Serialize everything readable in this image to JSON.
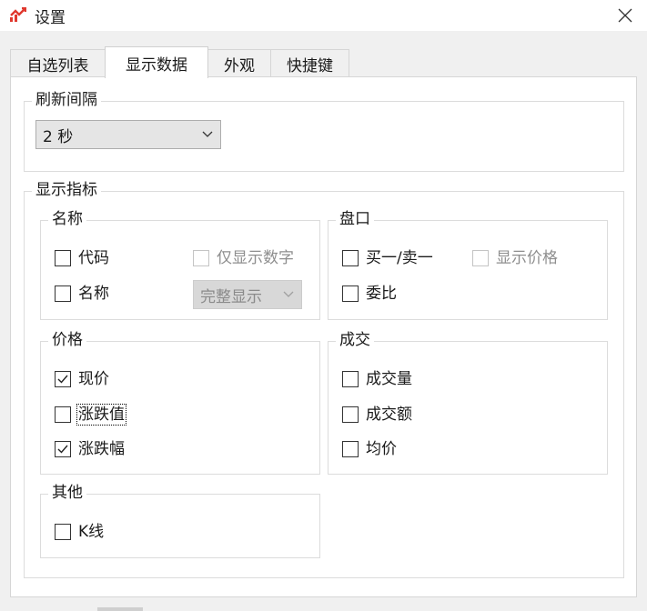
{
  "window": {
    "title": "设置",
    "accent": "#e0382e"
  },
  "tabs": [
    {
      "label": "自选列表",
      "active": false
    },
    {
      "label": "显示数据",
      "active": true
    },
    {
      "label": "外观",
      "active": false
    },
    {
      "label": "快捷键",
      "active": false
    }
  ],
  "refresh": {
    "title": "刷新间隔",
    "selected": "2 秒"
  },
  "indicators": {
    "title": "显示指标",
    "name_group": {
      "title": "名称",
      "code": {
        "label": "代码",
        "checked": false
      },
      "only_digits": {
        "label": "仅显示数字",
        "checked": false,
        "disabled": true
      },
      "name": {
        "label": "名称",
        "checked": false
      },
      "display_mode": {
        "selected": "完整显示",
        "disabled": true
      }
    },
    "orderbook_group": {
      "title": "盘口",
      "bid_ask": {
        "label": "买一/卖一",
        "checked": false
      },
      "show_price": {
        "label": "显示价格",
        "checked": false,
        "disabled": true
      },
      "ratio": {
        "label": "委比",
        "checked": false
      }
    },
    "price_group": {
      "title": "价格",
      "current": {
        "label": "现价",
        "checked": true
      },
      "change": {
        "label": "涨跌值",
        "checked": false
      },
      "change_pct": {
        "label": "涨跌幅",
        "checked": true
      }
    },
    "volume_group": {
      "title": "成交",
      "volume": {
        "label": "成交量",
        "checked": false
      },
      "amount": {
        "label": "成交额",
        "checked": false
      },
      "avg_price": {
        "label": "均价",
        "checked": false
      }
    },
    "other_group": {
      "title": "其他",
      "kline": {
        "label": "K线",
        "checked": false
      }
    }
  }
}
